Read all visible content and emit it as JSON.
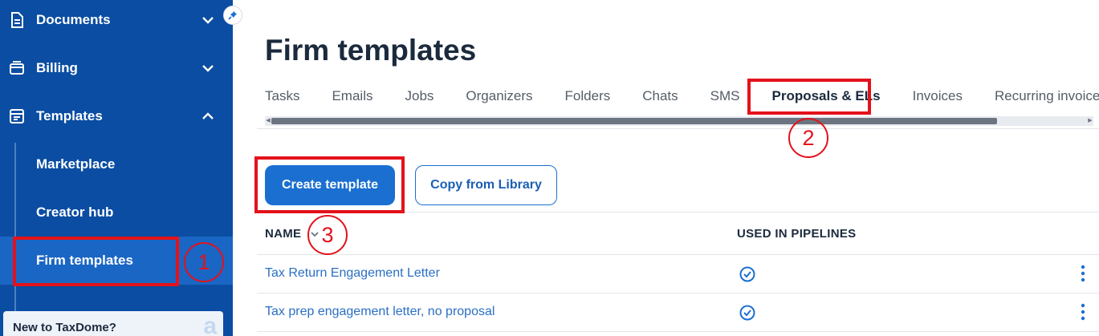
{
  "sidebar": {
    "items": [
      {
        "label": "Documents",
        "icon": "documents-icon"
      },
      {
        "label": "Billing",
        "icon": "billing-icon"
      },
      {
        "label": "Templates",
        "icon": "templates-icon"
      }
    ],
    "sub_items": [
      {
        "label": "Marketplace"
      },
      {
        "label": "Creator hub"
      },
      {
        "label": "Firm templates",
        "active": true
      }
    ],
    "promo": {
      "text": "New to TaxDome?",
      "logo": "a"
    }
  },
  "main": {
    "title": "Firm templates",
    "tabs": [
      {
        "label": "Tasks"
      },
      {
        "label": "Emails"
      },
      {
        "label": "Jobs"
      },
      {
        "label": "Organizers"
      },
      {
        "label": "Folders"
      },
      {
        "label": "Chats"
      },
      {
        "label": "SMS"
      },
      {
        "label": "Proposals & ELs",
        "active": true
      },
      {
        "label": "Invoices"
      },
      {
        "label": "Recurring invoices"
      }
    ],
    "buttons": {
      "create": "Create template",
      "copy": "Copy from Library"
    },
    "table": {
      "headers": {
        "name": "NAME",
        "pipelines": "USED IN PIPELINES"
      },
      "rows": [
        {
          "name": "Tax Return Engagement Letter",
          "used_in_pipelines": true
        },
        {
          "name": "Tax prep engagement letter, no proposal",
          "used_in_pipelines": true
        }
      ]
    }
  },
  "annotations": [
    "1",
    "2",
    "3"
  ],
  "colors": {
    "sidebar": "#0a4da2",
    "accent": "#1a6fd1",
    "annotation": "#e3121b"
  }
}
